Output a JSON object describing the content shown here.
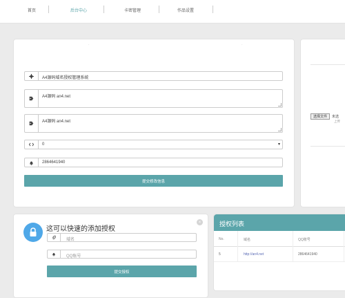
{
  "nav": {
    "items": [
      {
        "label": "首页",
        "active": false
      },
      {
        "label": "后台中心",
        "active": true
      },
      {
        "label": "卡密管理",
        "active": false
      },
      {
        "label": "作品设置",
        "active": false
      }
    ]
  },
  "settings": {
    "site_title": "A4源码域名授权管理系统",
    "keywords": "A4源码 an4.net",
    "description": "A4源码 an4.net",
    "select_value": "0",
    "qq": "2864641940",
    "submit_label": "提交修改信息"
  },
  "upload": {
    "choose_label": "选择文件",
    "no_file": "未选",
    "upload_label": "上传"
  },
  "quick_add": {
    "title": "这可以快速的添加授权",
    "domain_placeholder": "域名",
    "qq_placeholder": "QQ账号",
    "submit_label": "提交授权",
    "close_icon": "close-icon"
  },
  "auth_list": {
    "title": "授权列表",
    "headers": [
      "No.",
      "域名",
      "QQ账号"
    ],
    "rows": [
      {
        "no": "5",
        "domain": "http://an4.net",
        "qq": "2864641940"
      }
    ]
  },
  "colors": {
    "accent": "#5ba5aa",
    "background": "#ebebeb"
  },
  "icons": [
    "gear-icon",
    "tag-icon",
    "code-icon",
    "bell-icon",
    "lock-icon",
    "paperclip-icon"
  ]
}
